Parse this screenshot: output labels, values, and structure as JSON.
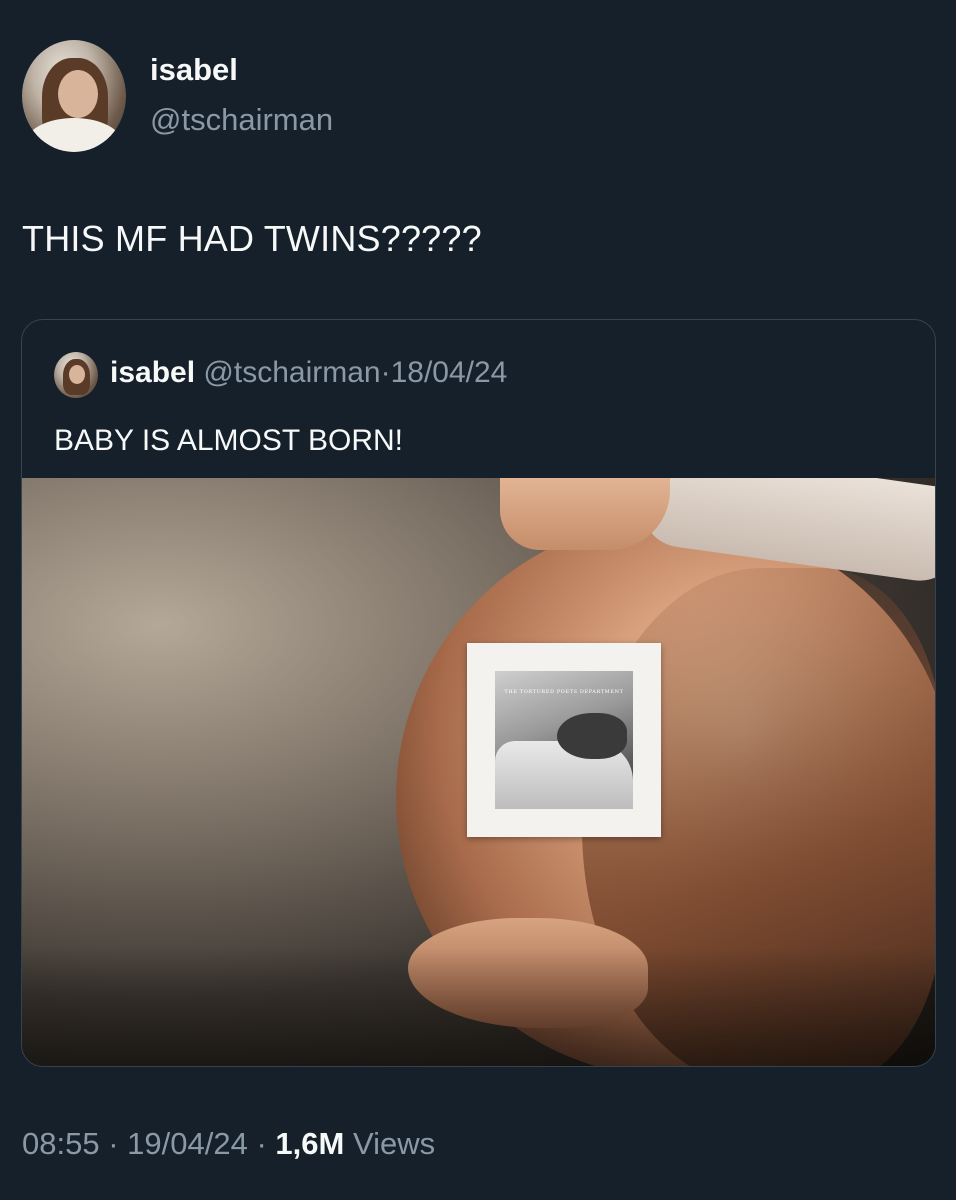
{
  "author": {
    "name": "isabel",
    "handle": "@tschairman"
  },
  "tweet": {
    "text": "THIS MF HAD TWINS?????"
  },
  "quoted_tweet": {
    "name": "isabel",
    "handle": "@tschairman",
    "separator": "·",
    "date": "18/04/24",
    "text": "BABY IS ALMOST BORN!",
    "image": {
      "album_cover_text": "THE TORTURED POETS DEPARTMENT"
    }
  },
  "footer": {
    "time": "08:55",
    "separator": "·",
    "date": "19/04/24",
    "views_count": "1,6M",
    "views_label": "Views"
  },
  "colors": {
    "background": "#15202b",
    "primary_text": "#f7f9f9",
    "secondary_text": "#8b98a5",
    "border": "#38444d"
  }
}
